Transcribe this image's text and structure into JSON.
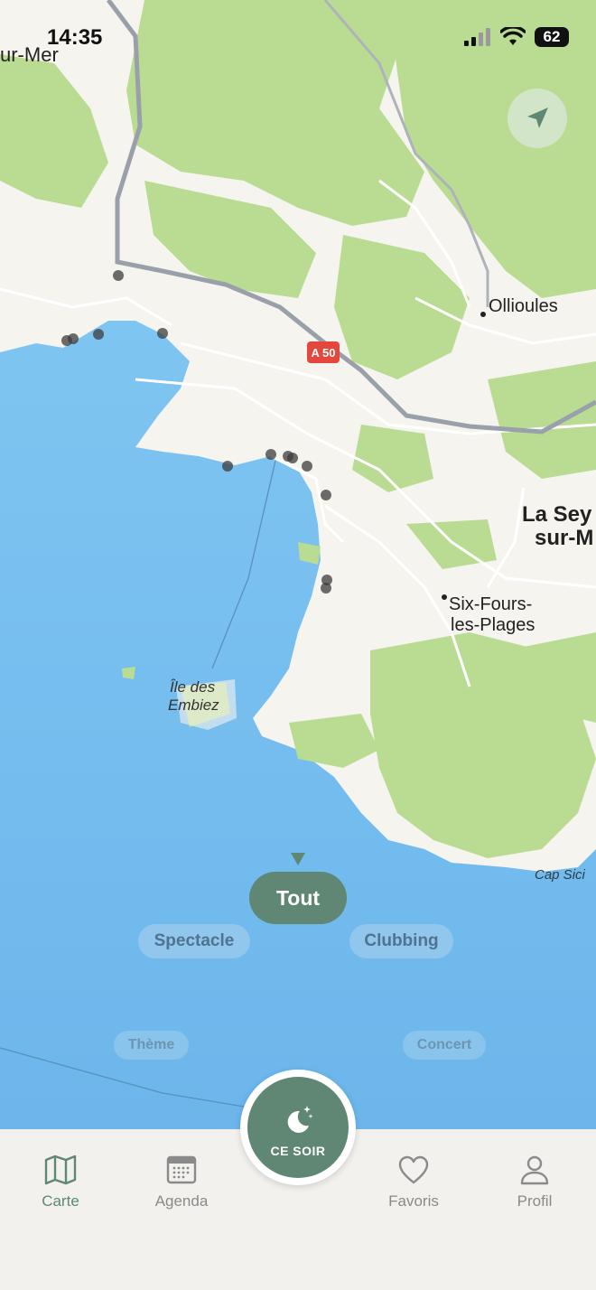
{
  "status_bar": {
    "time": "14:35",
    "battery": "62"
  },
  "map": {
    "labels": {
      "sur_mer": "ur-Mer",
      "ollioules": "Ollioules",
      "la_seyne_1": "La Sey",
      "la_seyne_2": "sur-M",
      "six_fours_1": "Six-Fours-",
      "six_fours_2": "les-Plages",
      "ile_1": "Île des",
      "ile_2": "Embiez",
      "cap_sicie": "Cap Sici",
      "road_shield": "A 50"
    },
    "colors": {
      "sea": "#7ec4ef",
      "land": "#f5f4ee",
      "vegetation": "#b9dc92",
      "road": "#9aa0aa",
      "shield": "#e4483c"
    }
  },
  "filters": {
    "selected": "Tout",
    "options": [
      "Spectacle",
      "Clubbing",
      "Thème",
      "Concert"
    ]
  },
  "tabbar": {
    "carte": "Carte",
    "agenda": "Agenda",
    "ce_soir": "CE SOIR",
    "favoris": "Favoris",
    "profil": "Profil"
  },
  "accent_color": "#5f8774"
}
